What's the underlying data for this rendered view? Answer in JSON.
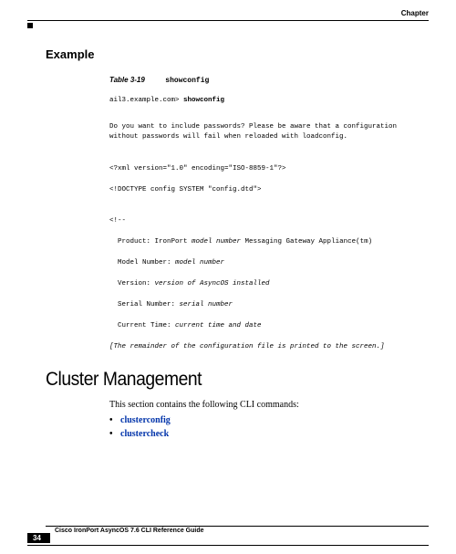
{
  "header": {
    "chapter": "Chapter"
  },
  "example": {
    "heading": "Example",
    "table_label": "Table 3-19",
    "table_name": "showconfig",
    "prompt_host": "ail3.example.com>",
    "prompt_cmd": "showconfig",
    "question": "Do you want to include passwords? Please be aware that a configuration without passwords will fail when reloaded with loadconfig.",
    "xml_decl": "<?xml version=\"1.0\" encoding=\"ISO-8859-1\"?>",
    "doctype": "<!DOCTYPE config SYSTEM \"config.dtd\">",
    "comment_open": "<!--",
    "product_prefix": "Product: IronPort ",
    "product_var": "model number",
    "product_suffix": " Messaging Gateway Appliance(tm)",
    "model_prefix": "Model Number: ",
    "model_var": "model number",
    "version_prefix": "Version: ",
    "version_var": "version of AsyncOS installed",
    "serial_prefix": "Serial Number: ",
    "serial_var": "serial number",
    "time_prefix": "Current Time: ",
    "time_var": "current time and date",
    "remainder": "[The remainder of the configuration file is printed to the screen.]"
  },
  "section": {
    "heading": "Cluster Management",
    "intro": "This section contains the following CLI commands:",
    "links": [
      "clusterconfig",
      "clustercheck"
    ]
  },
  "footer": {
    "title": "Cisco IronPort AsyncOS 7.6 CLI Reference Guide",
    "page": "34"
  }
}
